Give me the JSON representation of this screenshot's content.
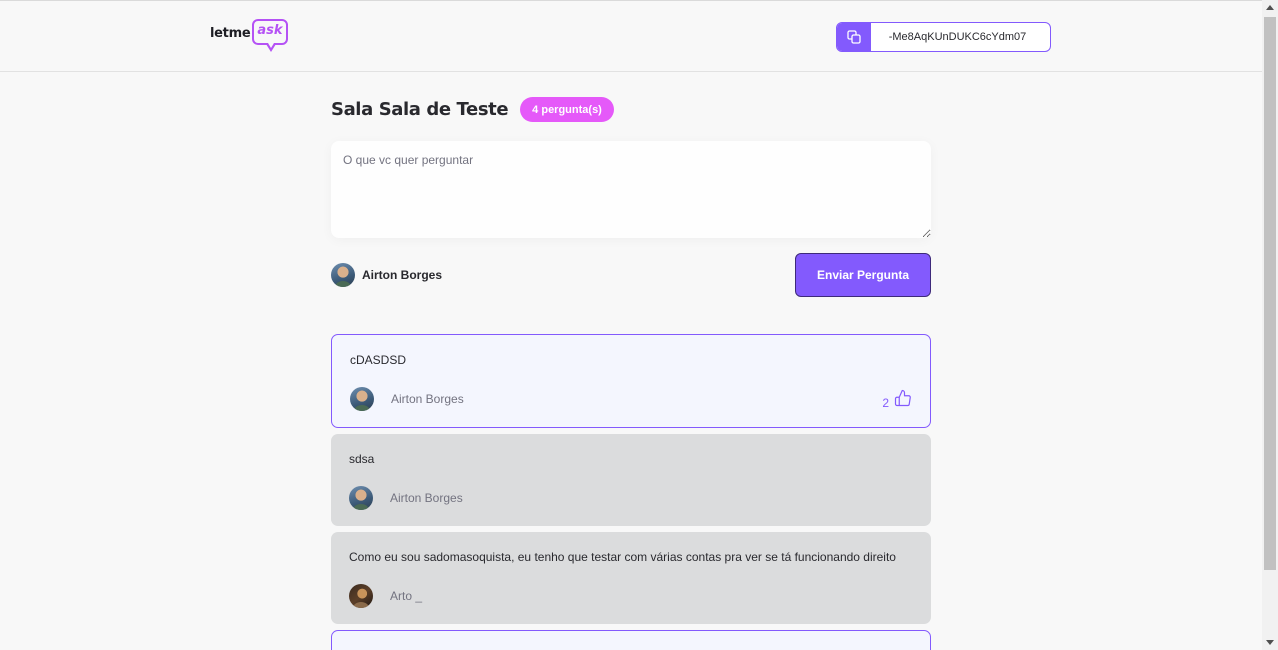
{
  "header": {
    "logo": {
      "part1": "letme",
      "part2": "ask"
    },
    "room_code": {
      "value": "-Me8AqKUnDUKC6cYdm07",
      "icon": "copy-icon"
    }
  },
  "room": {
    "title": "Sala Sala de Teste",
    "question_count_badge": "4 pergunta(s)"
  },
  "form": {
    "placeholder": "O que vc quer perguntar",
    "user_name": "Airton Borges",
    "submit_label": "Enviar Pergunta"
  },
  "questions": [
    {
      "content": "cDASDSD",
      "author": "Airton Borges",
      "likes": "2",
      "state": "highlighted",
      "like_icon": "thumbs-up-icon"
    },
    {
      "content": "sdsa",
      "author": "Airton Borges",
      "state": "answered"
    },
    {
      "content": "Como eu sou sadomasoquista, eu tenho que testar com várias contas pra ver se tá funcionando direito",
      "author": "Arto _",
      "state": "answered"
    }
  ],
  "colors": {
    "primary": "#835afd",
    "accent_pink": "#e559f9",
    "background": "#f8f8f8",
    "highlighted_bg": "#f4f6fe",
    "answered_bg": "#dbdcdd"
  }
}
